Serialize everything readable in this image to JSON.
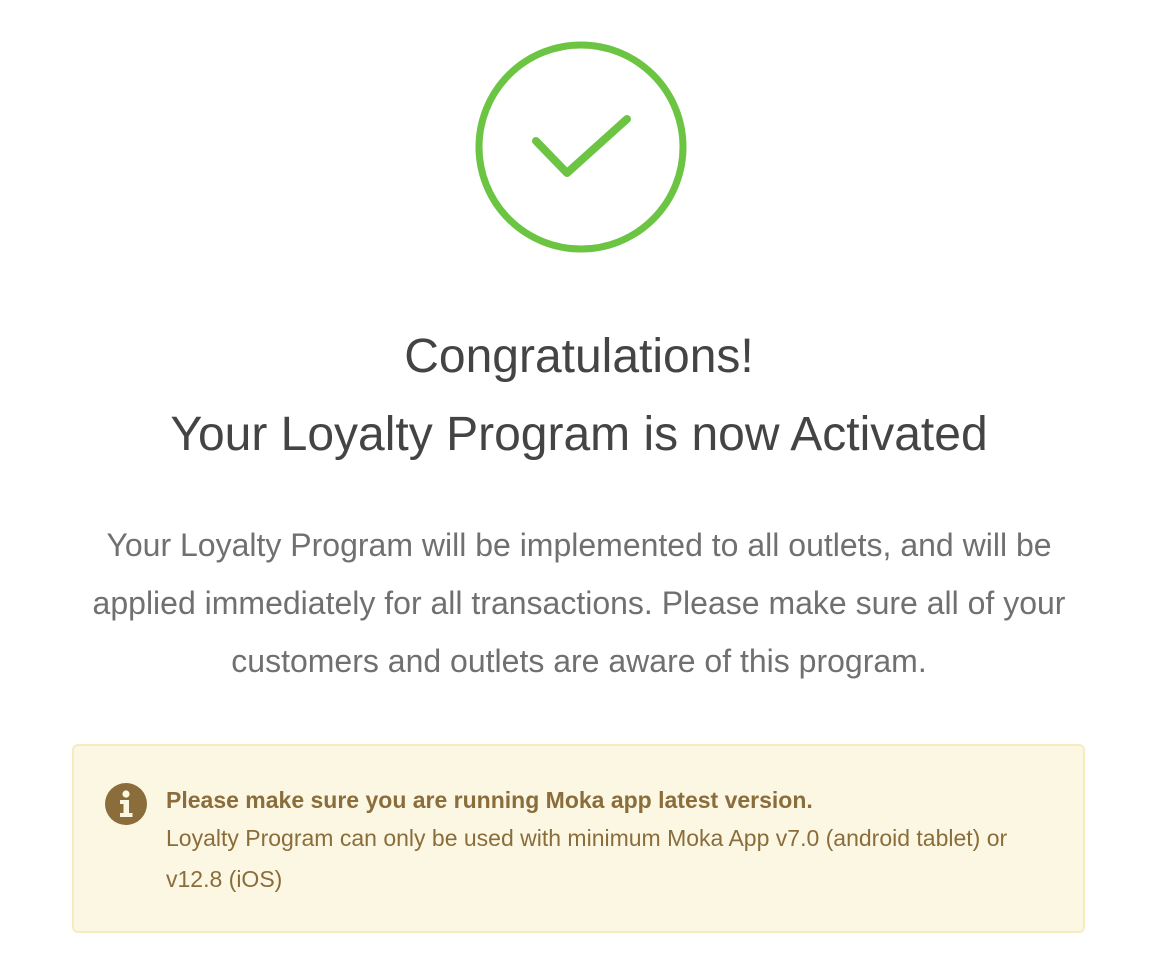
{
  "success": {
    "icon": "checkmark-circle-icon",
    "color": "#6cc443"
  },
  "heading": {
    "line1": "Congratulations!",
    "line2": "Your Loyalty Program is now Activated"
  },
  "description": "Your Loyalty Program will be implemented to all outlets, and will be applied immediately for all transactions. Please make sure all of your customers and outlets are aware of this program.",
  "alert": {
    "icon": "info-icon",
    "title": "Please make sure you are running Moka app latest version.",
    "body": "Loyalty Program can only be used with minimum Moka App v7.0 (android tablet) or v12.8 (iOS)",
    "background": "#fcf7e3",
    "text_color": "#8a6d3b"
  }
}
